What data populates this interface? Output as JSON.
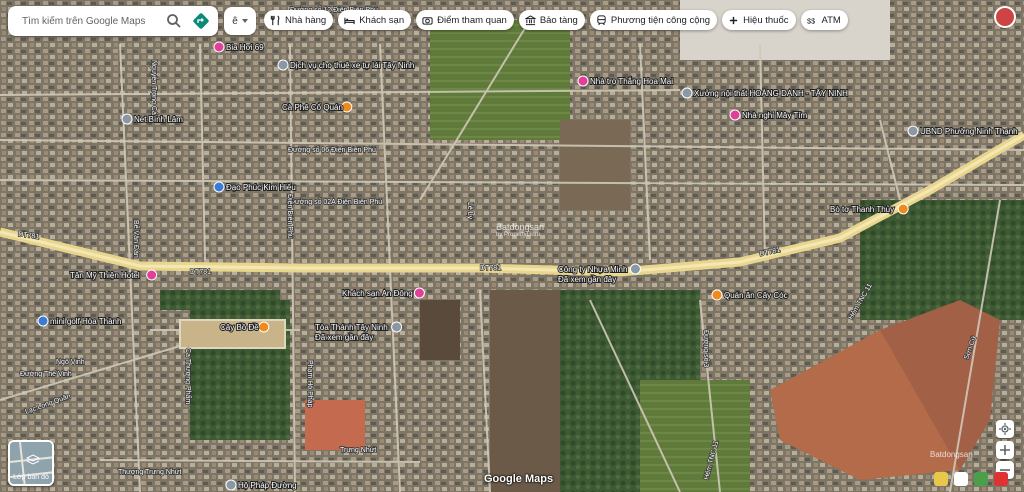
{
  "search": {
    "placeholder": "Tìm kiếm trên Google Maps"
  },
  "lang_label": "ê",
  "chips": [
    {
      "label": "Nhà hàng",
      "icon": "restaurant-icon"
    },
    {
      "label": "Khách sạn",
      "icon": "hotel-icon"
    },
    {
      "label": "Điểm tham quan",
      "icon": "camera-icon"
    },
    {
      "label": "Bảo tàng",
      "icon": "museum-icon"
    },
    {
      "label": "Phương tiện công cộng",
      "icon": "transit-icon"
    },
    {
      "label": "Hiệu thuốc",
      "icon": "pharmacy-icon"
    },
    {
      "label": "ATM",
      "icon": "atm-icon"
    }
  ],
  "layers_label": "Lớp bản đồ",
  "logo": "Google Maps",
  "watermark": "Batdongsan",
  "watermark_sub": "by PropertyGuru",
  "colors": {
    "highway": "#e8d58e",
    "road": "#cfc9b8",
    "poi_pink": "#e0409a",
    "poi_orange": "#f08a1a",
    "poi_gray": "#8a97a4",
    "poi_blue": "#3b7bd6"
  },
  "places": [
    {
      "name": "Bia Hơi 69",
      "type": "pink"
    },
    {
      "name": "Dịch vụ cho thuê xe tự lái Tây Ninh",
      "type": "gray"
    },
    {
      "name": "Cà Phê Cổ Quán",
      "type": "orange"
    },
    {
      "name": "Net Bình Lâm",
      "type": "gray"
    },
    {
      "name": "Đạo Phúc Kim Hiếu",
      "type": "blue"
    },
    {
      "name": "Nhà trọ Thắng Hoa Mai",
      "type": "pink"
    },
    {
      "name": "Xưởng nội thất HOÀNG DANH - TÂY NINH",
      "type": "gray"
    },
    {
      "name": "Nhà nghỉ Mây Tím",
      "type": "pink"
    },
    {
      "name": "UBND Phường Ninh Thạnh",
      "type": "gray"
    },
    {
      "name": "Bò tơ Thanh Thủy",
      "type": "orange"
    },
    {
      "name": "Công ty Nhựa Minh",
      "type": "gray"
    },
    {
      "name": "Đã xem gần đây",
      "type": "text"
    },
    {
      "name": "Khách sạn An Đông",
      "type": "pink"
    },
    {
      "name": "Quán ăn Cây Cóc",
      "type": "orange"
    },
    {
      "name": "Tân Mỹ Thiện Hotel",
      "type": "pink"
    },
    {
      "name": "mini golf Hòa Thành",
      "type": "blue"
    },
    {
      "name": "Cây Bồ Đề",
      "type": "orange"
    },
    {
      "name": "Tòa Thánh Tây Ninh",
      "type": "gray"
    },
    {
      "name": "Đã xem gần đây",
      "type": "text"
    },
    {
      "name": "Hộ Pháp Đường",
      "type": "gray"
    }
  ],
  "roads": [
    "DT781",
    "DT781",
    "DT781",
    "DT781",
    "Đường số 12 Điện Biên Phủ",
    "Đường số 06 Điện Biên Phủ",
    "Đường số 02A Điện Biên Phủ",
    "Nguyễn Trọng Cát",
    "Điện Biên Phủ",
    "Lạc Long Quân",
    "Phạm Hộ Pháp",
    "Trưng Nhứt",
    "Thượng Trưng Nhứt",
    "Hẻm TNC 11",
    "Hẻm TNC 11",
    "Sơn Cứ",
    "Đường số 3",
    "Ngô Vinh",
    "Đường Thế Vinh",
    "Ca Thượng Phẩm",
    "Bế Văn Đàn",
    "Lê Lý"
  ]
}
